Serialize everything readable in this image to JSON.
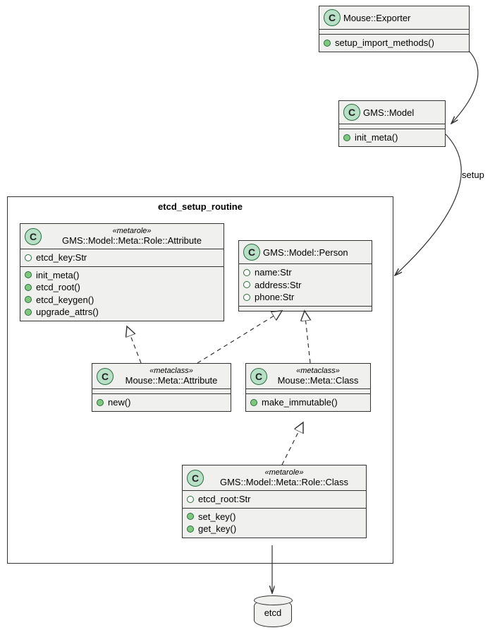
{
  "package": {
    "title": "etcd_setup_routine"
  },
  "exporter": {
    "name": "Mouse::Exporter",
    "methods": [
      "setup_import_methods()"
    ]
  },
  "gmsmodel": {
    "name": "GMS::Model",
    "methods": [
      "init_meta()"
    ]
  },
  "roleattr": {
    "stereotype": "«metarole»",
    "name": "GMS::Model::Meta::Role::Attribute",
    "attrs": [
      "etcd_key:Str"
    ],
    "methods": [
      "init_meta()",
      "etcd_root()",
      "etcd_keygen()",
      "upgrade_attrs()"
    ]
  },
  "person": {
    "name": "GMS::Model::Person",
    "attrs": [
      "name:Str",
      "address:Str",
      "phone:Str"
    ]
  },
  "metaattr": {
    "stereotype": "«metaclass»",
    "name": "Mouse::Meta::Attribute",
    "methods": [
      "new()"
    ]
  },
  "metaclass": {
    "stereotype": "«metaclass»",
    "name": "Mouse::Meta::Class",
    "methods": [
      "make_immutable()"
    ]
  },
  "roleclass": {
    "stereotype": "«metarole»",
    "name": "GMS::Model::Meta::Role::Class",
    "attrs": [
      "etcd_root:Str"
    ],
    "methods": [
      "set_key()",
      "get_key()"
    ]
  },
  "db": {
    "label": "etcd"
  },
  "edge_label": "setup",
  "chart_data": {
    "type": "uml-class-diagram",
    "package": "etcd_setup_routine",
    "classes": [
      {
        "id": "exporter",
        "name": "Mouse::Exporter",
        "methods": [
          "setup_import_methods()"
        ]
      },
      {
        "id": "gmsmodel",
        "name": "GMS::Model",
        "methods": [
          "init_meta()"
        ]
      },
      {
        "id": "roleattr",
        "stereotype": "metarole",
        "name": "GMS::Model::Meta::Role::Attribute",
        "in_package": true,
        "attributes": [
          {
            "name": "etcd_key",
            "type": "Str",
            "vis": "private"
          }
        ],
        "methods": [
          "init_meta()",
          "etcd_root()",
          "etcd_keygen()",
          "upgrade_attrs()"
        ]
      },
      {
        "id": "person",
        "name": "GMS::Model::Person",
        "in_package": true,
        "attributes": [
          {
            "name": "name",
            "type": "Str",
            "vis": "private"
          },
          {
            "name": "address",
            "type": "Str",
            "vis": "private"
          },
          {
            "name": "phone",
            "type": "Str",
            "vis": "private"
          }
        ]
      },
      {
        "id": "metaattr",
        "stereotype": "metaclass",
        "name": "Mouse::Meta::Attribute",
        "in_package": true,
        "methods": [
          "new()"
        ]
      },
      {
        "id": "metaclass",
        "stereotype": "metaclass",
        "name": "Mouse::Meta::Class",
        "in_package": true,
        "methods": [
          "make_immutable()"
        ]
      },
      {
        "id": "roleclass",
        "stereotype": "metarole",
        "name": "GMS::Model::Meta::Role::Class",
        "in_package": true,
        "attributes": [
          {
            "name": "etcd_root",
            "type": "Str",
            "vis": "private"
          }
        ],
        "methods": [
          "set_key()",
          "get_key()"
        ]
      }
    ],
    "database": {
      "id": "etcd",
      "label": "etcd"
    },
    "relations": [
      {
        "from": "exporter",
        "to": "gmsmodel",
        "type": "arrow"
      },
      {
        "from": "gmsmodel",
        "to": "package",
        "type": "arrow",
        "label": "setup"
      },
      {
        "from": "metaattr",
        "to": "roleattr",
        "type": "realization-dashed"
      },
      {
        "from": "metaattr",
        "to": "person",
        "type": "realization-dashed"
      },
      {
        "from": "metaclass",
        "to": "person",
        "type": "realization-dashed"
      },
      {
        "from": "metaclass",
        "to": "roleclass",
        "type": "realization-dashed"
      },
      {
        "from": "roleclass",
        "to": "etcd",
        "type": "arrow"
      }
    ]
  }
}
